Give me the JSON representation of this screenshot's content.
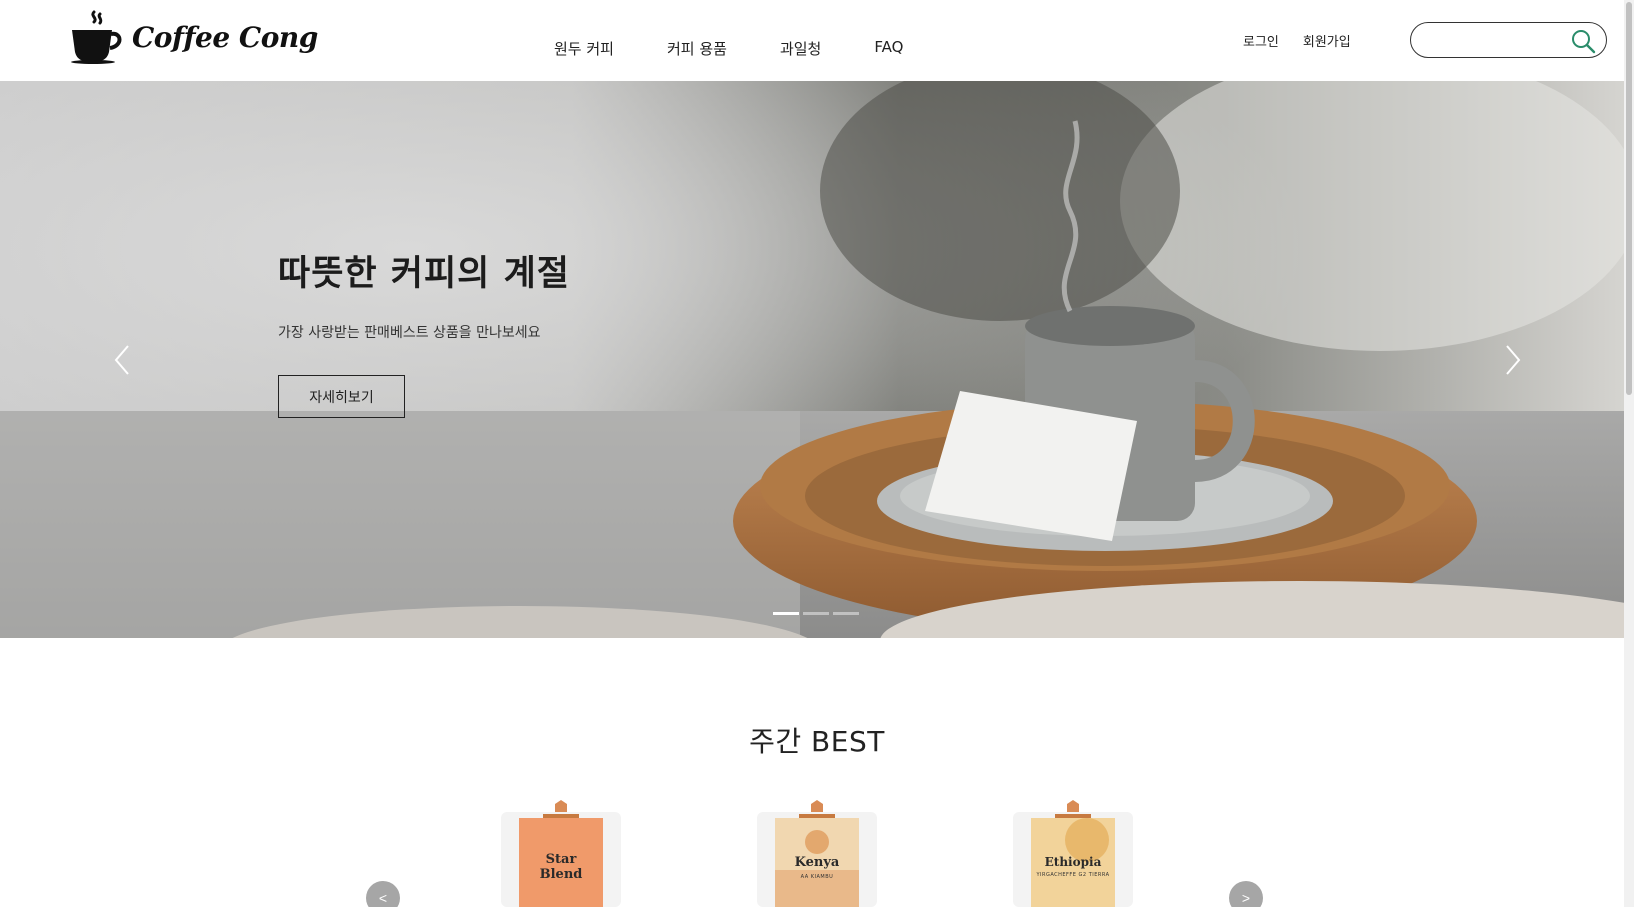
{
  "header": {
    "logo_text": "Coffee Cong",
    "nav": [
      "원두 커피",
      "커피 용품",
      "과일청",
      "FAQ"
    ],
    "login": "로그인",
    "signup": "회원가입",
    "search": {
      "placeholder": "",
      "value": ""
    }
  },
  "hero": {
    "title": "따뜻한 커피의 계절",
    "subtitle": "가장 사랑받는 판매베스트 상품을 만나보세요",
    "button": "자세히보기",
    "slides_total": 3,
    "active_slide": 1
  },
  "best": {
    "title": "주간 BEST",
    "prev_label": "<",
    "next_label": ">",
    "products": [
      {
        "name_line1": "Star",
        "name_line2": "Blend",
        "tag": "",
        "color": "#f09a6a"
      },
      {
        "name_line1": "Kenya",
        "name_line2": "",
        "tag": "AA KIAMBU",
        "color": "#f1d7b0"
      },
      {
        "name_line1": "Ethiopia",
        "name_line2": "",
        "tag": "YIRGACHEFFE G2 TIERRA",
        "color": "#f2d39a"
      }
    ]
  },
  "colors": {
    "accent": "#2a8c6a",
    "text": "#222222"
  }
}
